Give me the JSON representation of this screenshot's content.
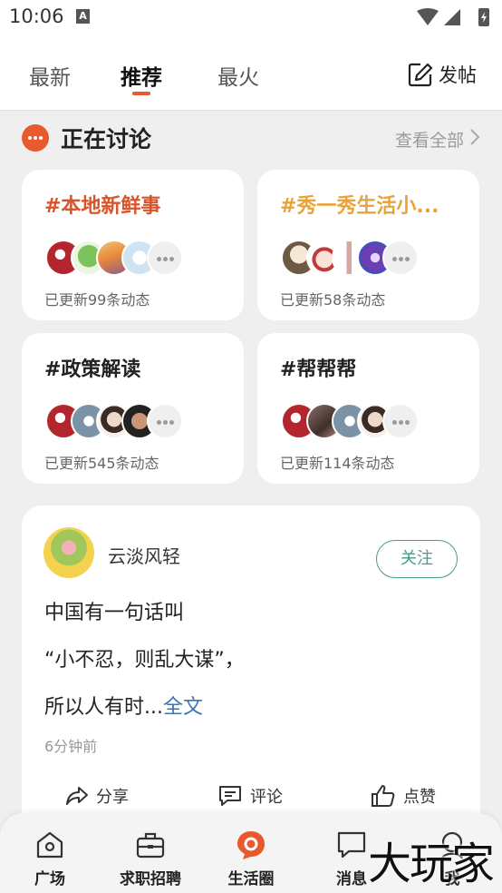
{
  "status_bar": {
    "time": "10:06",
    "notif_letter": "A"
  },
  "header": {
    "tabs": [
      {
        "label": "最新",
        "active": false
      },
      {
        "label": "推荐",
        "active": true
      },
      {
        "label": "最火",
        "active": false
      }
    ],
    "post_label": "发帖"
  },
  "discussion": {
    "title": "正在讨论",
    "see_all": "查看全部"
  },
  "topics": [
    {
      "title": "#本地新鲜事",
      "count": "已更新99条动态",
      "color": "#d9532b"
    },
    {
      "title": "#秀一秀生活小...",
      "count": "已更新58条动态",
      "color": "#e8a33a"
    },
    {
      "title": "#政策解读",
      "count": "已更新545条动态",
      "color": "#222222"
    },
    {
      "title": "#帮帮帮",
      "count": "已更新114条动态",
      "color": "#222222"
    }
  ],
  "post": {
    "author": "云淡风轻",
    "follow_label": "关注",
    "lines": [
      "中国有一句话叫",
      "“小不忍，则乱大谋”，",
      "所以人有时..."
    ],
    "full_text_link": "全文",
    "time": "6分钟前",
    "actions": {
      "share": "分享",
      "comment": "评论",
      "like": "点赞"
    }
  },
  "bottom_nav": [
    {
      "label": "广场",
      "icon": "plaza-icon"
    },
    {
      "label": "求职招聘",
      "icon": "briefcase-icon"
    },
    {
      "label": "生活圈",
      "icon": "life-circle-icon",
      "active": true
    },
    {
      "label": "消息",
      "icon": "message-icon"
    },
    {
      "label": "我",
      "icon": "profile-icon"
    }
  ],
  "watermark": "大玩家",
  "colors": {
    "accent": "#e8592e",
    "follow": "#4a9b8e",
    "link": "#3d73b0"
  }
}
